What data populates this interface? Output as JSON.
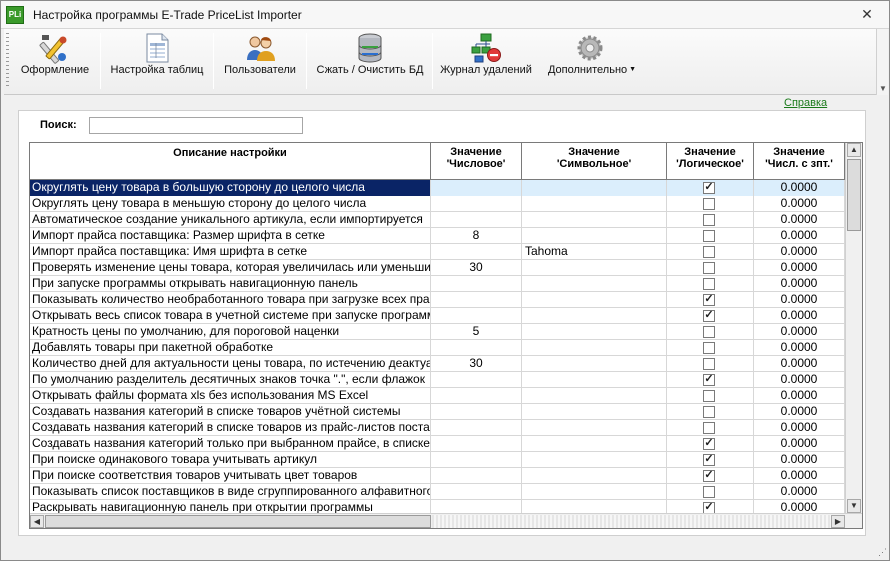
{
  "window": {
    "app_icon_text": "PLi",
    "title": "Настройка программы E-Trade PriceList Importer",
    "close_symbol": "✕"
  },
  "toolbar": {
    "buttons": [
      {
        "label": "Оформление",
        "icon": "appearance-tools-icon"
      },
      {
        "label": "Настройка таблиц",
        "icon": "table-settings-icon"
      },
      {
        "label": "Пользователи",
        "icon": "users-icon"
      },
      {
        "label": "Сжать / Очистить БД",
        "icon": "database-icon"
      },
      {
        "label": "Журнал удалений",
        "icon": "deletion-log-icon"
      },
      {
        "label": "Дополнительно",
        "icon": "gear-icon",
        "has_dropdown": true
      }
    ]
  },
  "help_link": "Справка",
  "search": {
    "label": "Поиск:",
    "value": "",
    "placeholder": ""
  },
  "table": {
    "columns": [
      {
        "line1": "Описание настройки",
        "line2": ""
      },
      {
        "line1": "Значение",
        "line2": "'Числовое'"
      },
      {
        "line1": "Значение",
        "line2": "'Символьное'"
      },
      {
        "line1": "Значение",
        "line2": "'Логическое'"
      },
      {
        "line1": "Значение",
        "line2": "'Числ. с зпт.'"
      }
    ],
    "selected_row": 0,
    "rows": [
      {
        "desc": "Округлять цену товара в большую сторону до целого числа",
        "num": "",
        "str": "",
        "bool": true,
        "float": "0.0000"
      },
      {
        "desc": "Округлять цену товара в меньшую сторону до целого числа",
        "num": "",
        "str": "",
        "bool": false,
        "float": "0.0000"
      },
      {
        "desc": "Автоматическое создание уникального артикула, если импортируется",
        "num": "",
        "str": "",
        "bool": false,
        "float": "0.0000"
      },
      {
        "desc": "Импорт прайса поставщика: Размер шрифта в сетке",
        "num": "8",
        "str": "",
        "bool": false,
        "float": "0.0000"
      },
      {
        "desc": "Импорт прайса поставщика: Имя шрифта в сетке",
        "num": "",
        "str": "Tahoma",
        "bool": false,
        "float": "0.0000"
      },
      {
        "desc": "Проверять изменение цены товара, которая увеличилась или уменьшилась",
        "num": "30",
        "str": "",
        "bool": false,
        "float": "0.0000"
      },
      {
        "desc": "При запуске программы открывать навигационную панель",
        "num": "",
        "str": "",
        "bool": false,
        "float": "0.0000"
      },
      {
        "desc": "Показывать количество необработанного товара при загрузке всех прайсов",
        "num": "",
        "str": "",
        "bool": true,
        "float": "0.0000"
      },
      {
        "desc": "Открывать весь список товара в учетной системе при запуске программы",
        "num": "",
        "str": "",
        "bool": true,
        "float": "0.0000"
      },
      {
        "desc": "Кратность цены по умолчанию, для пороговой наценки",
        "num": "5",
        "str": "",
        "bool": false,
        "float": "0.0000"
      },
      {
        "desc": "Добавлять товары при пакетной обработке",
        "num": "",
        "str": "",
        "bool": false,
        "float": "0.0000"
      },
      {
        "desc": "Количество дней для актуальности цены товара, по истечению деактуализации",
        "num": "30",
        "str": "",
        "bool": false,
        "float": "0.0000"
      },
      {
        "desc": "По умолчанию разделитель десятичных знаков точка \".\", если флажок",
        "num": "",
        "str": "",
        "bool": true,
        "float": "0.0000"
      },
      {
        "desc": "Открывать файлы формата xls без использования MS Excel",
        "num": "",
        "str": "",
        "bool": false,
        "float": "0.0000"
      },
      {
        "desc": "Создавать названия категорий в списке товаров учётной системы",
        "num": "",
        "str": "",
        "bool": false,
        "float": "0.0000"
      },
      {
        "desc": "Создавать названия категорий в списке товаров из прайс-листов поставщиков",
        "num": "",
        "str": "",
        "bool": false,
        "float": "0.0000"
      },
      {
        "desc": "Создавать названия категорий только при выбранном прайсе, в списке",
        "num": "",
        "str": "",
        "bool": true,
        "float": "0.0000"
      },
      {
        "desc": "При поиске одинакового товара учитывать артикул",
        "num": "",
        "str": "",
        "bool": true,
        "float": "0.0000"
      },
      {
        "desc": "При поиске соответствия товаров учитывать цвет товаров",
        "num": "",
        "str": "",
        "bool": true,
        "float": "0.0000"
      },
      {
        "desc": "Показывать список поставщиков в виде сгруппированного алфавитного",
        "num": "",
        "str": "",
        "bool": false,
        "float": "0.0000"
      },
      {
        "desc": "Раскрывать навигационную панель при открытии программы",
        "num": "",
        "str": "",
        "bool": true,
        "float": "0.0000"
      }
    ]
  },
  "colors": {
    "selection": "#0a2466",
    "selection_row": "#dbeefc",
    "help_link": "#1a7a1a"
  }
}
